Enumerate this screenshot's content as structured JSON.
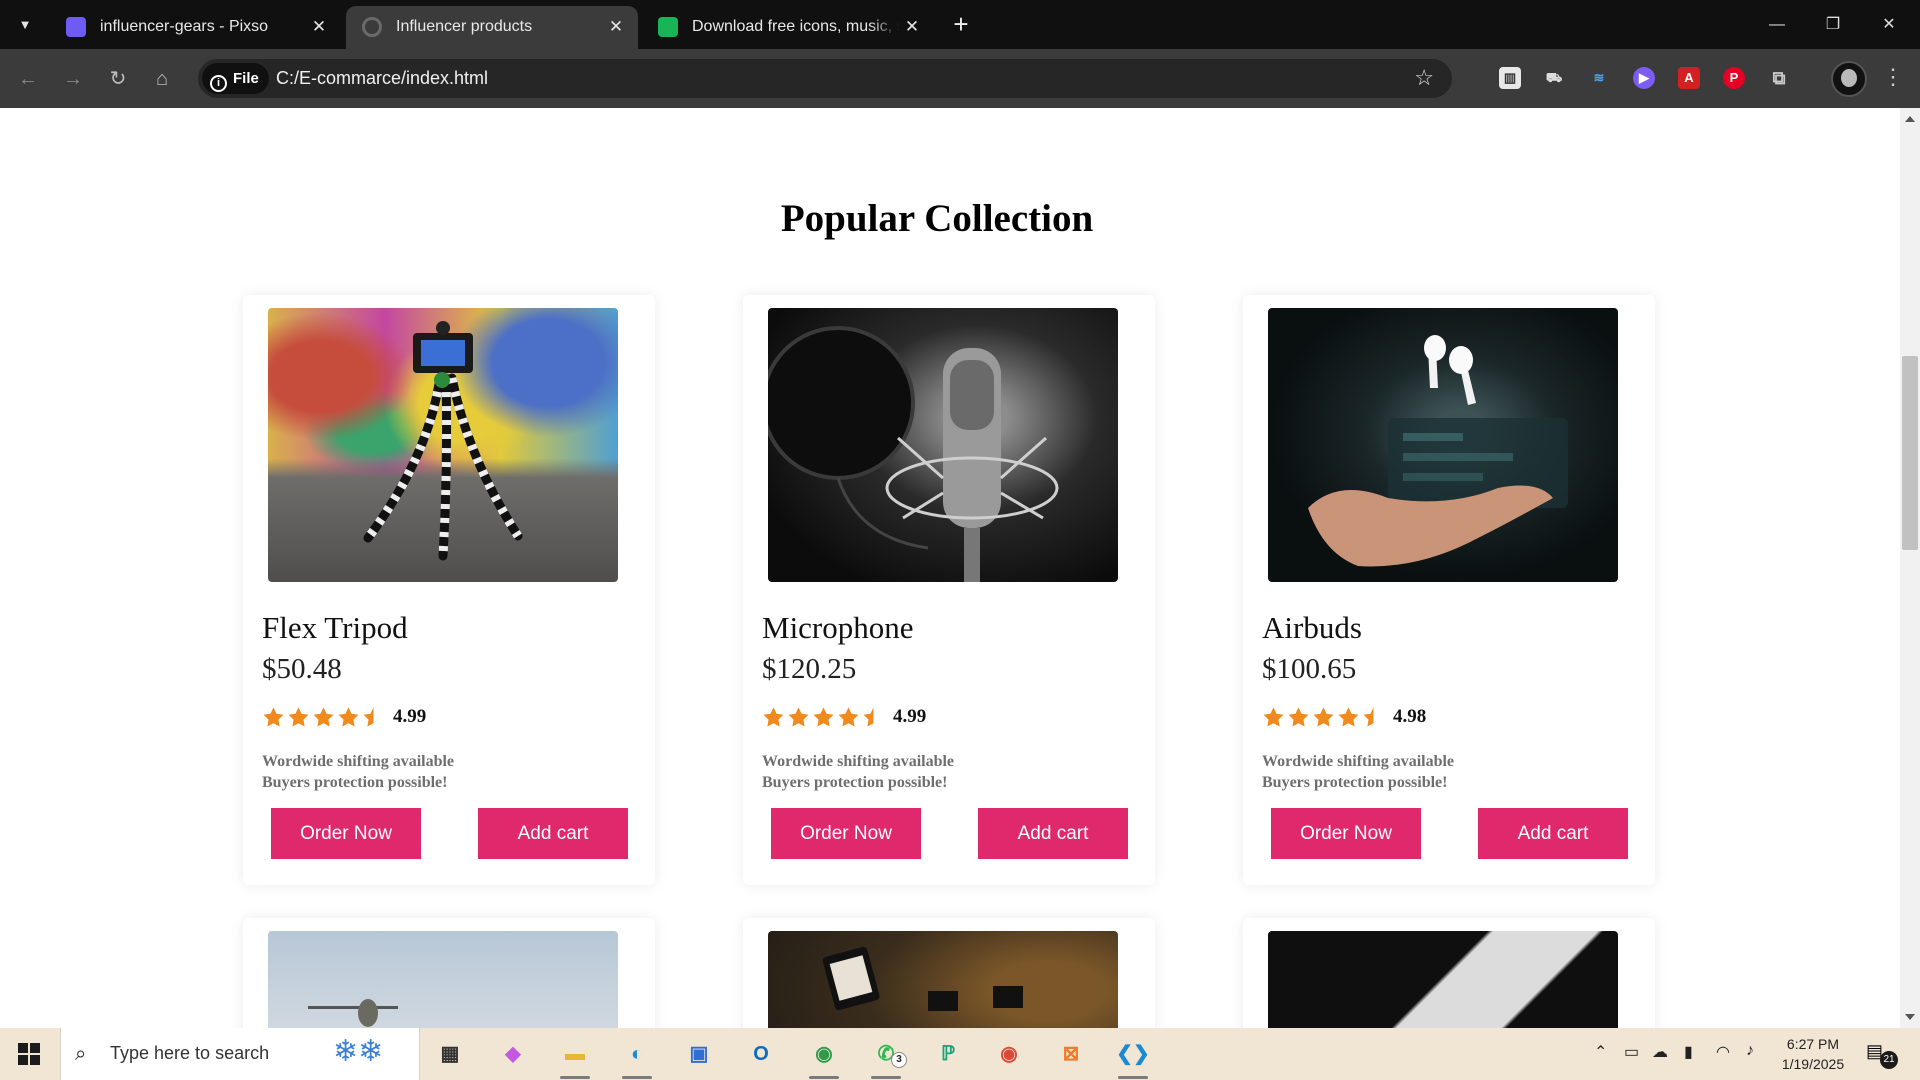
{
  "browser": {
    "tabs": [
      {
        "title": "influencer-gears - Pixso",
        "close": "✕"
      },
      {
        "title": "Influencer products",
        "close": "✕"
      },
      {
        "title": "Download free icons, music, stock",
        "close": "✕"
      }
    ],
    "new_tab": "+",
    "address": {
      "chip_label": "File",
      "url": "C:/E-commarce/index.html"
    }
  },
  "page": {
    "section_title": "Popular Collection",
    "products": [
      {
        "name": "Flex Tripod",
        "price": "$50.48",
        "rating": "4.99",
        "rating_stars": 4.5,
        "ship_line1": "Wordwide shifting available",
        "ship_line2": "Buyers protection possible!",
        "order_label": "Order Now",
        "cart_label": "Add cart"
      },
      {
        "name": "Microphone",
        "price": "$120.25",
        "rating": "4.99",
        "rating_stars": 4.5,
        "ship_line1": "Wordwide shifting available",
        "ship_line2": "Buyers protection possible!",
        "order_label": "Order Now",
        "cart_label": "Add cart"
      },
      {
        "name": "Airbuds",
        "price": "$100.65",
        "rating": "4.98",
        "rating_stars": 4.5,
        "ship_line1": "Wordwide shifting available",
        "ship_line2": "Buyers protection possible!",
        "order_label": "Order Now",
        "cart_label": "Add cart"
      }
    ],
    "colors": {
      "button": "#e0286d",
      "star": "#f08a1c"
    }
  },
  "taskbar": {
    "search_placeholder": "Type here to search",
    "whatsapp_badge": "3",
    "clock_time": "6:27 PM",
    "clock_date": "1/19/2025",
    "notification_count": "21"
  }
}
